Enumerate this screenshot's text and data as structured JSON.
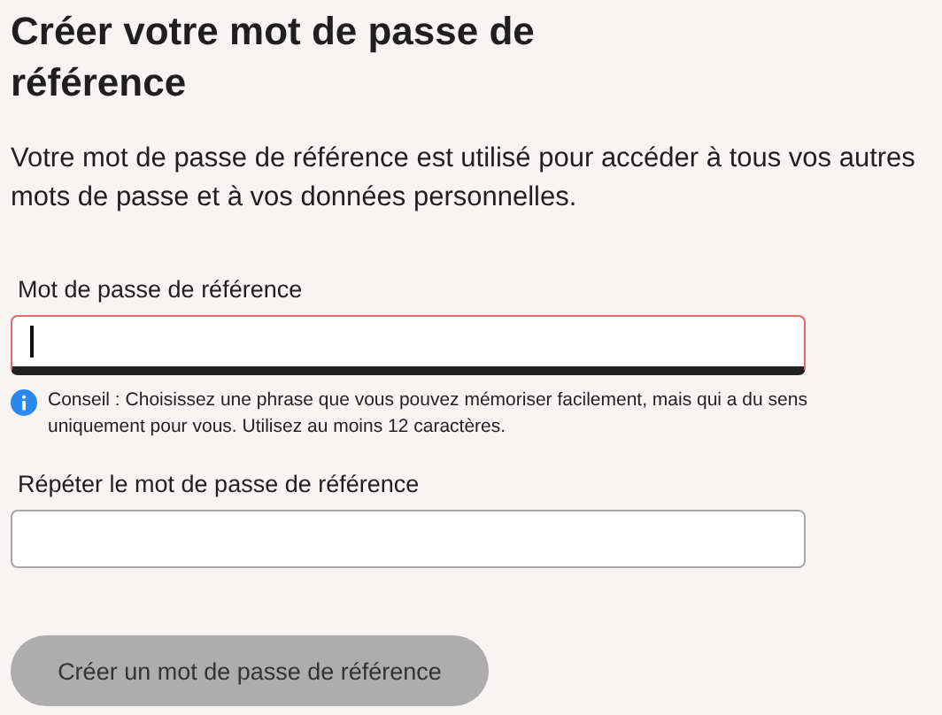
{
  "title": "Créer votre mot de passe de référence",
  "description": "Votre mot de passe de référence est utilisé pour accéder à tous vos autres mots de passe et à vos données personnelles.",
  "fields": [
    {
      "label": "Mot de passe de référence",
      "focused": true,
      "hint": "Conseil : Choisissez une phrase que vous pouvez mémoriser facilement, mais qui a du sens uniquement pour vous. Utilisez au moins 12 caractères."
    },
    {
      "label": "Répéter le mot de passe de référence",
      "focused": false
    }
  ],
  "button": {
    "label": "Créer un mot de passe de référence",
    "disabled": true
  }
}
